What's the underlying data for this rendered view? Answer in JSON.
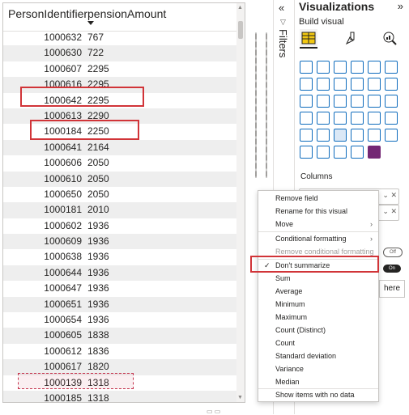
{
  "table": {
    "columns": [
      "PersonIdentifier",
      "pensionAmount"
    ],
    "rows": [
      [
        "1000632",
        "767"
      ],
      [
        "1000630",
        "722"
      ],
      [
        "1000607",
        "2295"
      ],
      [
        "1000616",
        "2295"
      ],
      [
        "1000642",
        "2295"
      ],
      [
        "1000613",
        "2290"
      ],
      [
        "1000184",
        "2250"
      ],
      [
        "1000641",
        "2164"
      ],
      [
        "1000606",
        "2050"
      ],
      [
        "1000610",
        "2050"
      ],
      [
        "1000650",
        "2050"
      ],
      [
        "1000181",
        "2010"
      ],
      [
        "1000602",
        "1936"
      ],
      [
        "1000609",
        "1936"
      ],
      [
        "1000638",
        "1936"
      ],
      [
        "1000644",
        "1936"
      ],
      [
        "1000647",
        "1936"
      ],
      [
        "1000651",
        "1936"
      ],
      [
        "1000654",
        "1936"
      ],
      [
        "1000605",
        "1838"
      ],
      [
        "1000612",
        "1836"
      ],
      [
        "1000617",
        "1820"
      ],
      [
        "1000139",
        "1318"
      ],
      [
        "1000185",
        "1318"
      ]
    ]
  },
  "filters": {
    "label": "Filters"
  },
  "visualizations": {
    "title": "Visualizations",
    "build_visual": "Build visual",
    "columns_label": "Columns",
    "toggle_off": "Off",
    "toggle_on": "On",
    "add_here": "here"
  },
  "context_menu": {
    "items": [
      {
        "label": "Remove field"
      },
      {
        "label": "Rename for this visual"
      },
      {
        "label": "Move"
      },
      {
        "label": "Conditional formatting"
      },
      {
        "label": "Remove conditional formatting"
      },
      {
        "label": "Don't summarize"
      },
      {
        "label": "Sum"
      },
      {
        "label": "Average"
      },
      {
        "label": "Minimum"
      },
      {
        "label": "Maximum"
      },
      {
        "label": "Count (Distinct)"
      },
      {
        "label": "Count"
      },
      {
        "label": "Standard deviation"
      },
      {
        "label": "Variance"
      },
      {
        "label": "Median"
      },
      {
        "label": "Show items with no data"
      }
    ]
  },
  "colors": {
    "highlight": "#d13438",
    "accent": "#0f6cbd"
  }
}
